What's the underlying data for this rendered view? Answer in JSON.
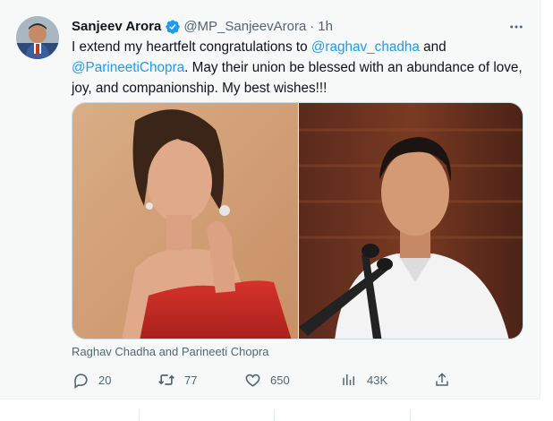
{
  "tweet": {
    "author_name": "Sanjeev Arora",
    "handle": "@MP_SanjeevArora",
    "separator": "·",
    "time": "1h",
    "more_icon": "more-horizontal-icon",
    "text_parts": {
      "t1": "I extend my heartfelt congratulations to ",
      "m1": "@raghav_chadha",
      "t2": " and",
      "m2": "@ParineetiChopra",
      "t3": ". May their union be blessed with an abundance of love,",
      "t4": "joy, and companionship. My best wishes!!!"
    },
    "media_caption": "Raghav Chadha and Parineeti Chopra",
    "accent_color": "#1d9bf0"
  },
  "actions": {
    "reply_count": "20",
    "retweet_count": "77",
    "like_count": "650",
    "views_count": "43K"
  }
}
